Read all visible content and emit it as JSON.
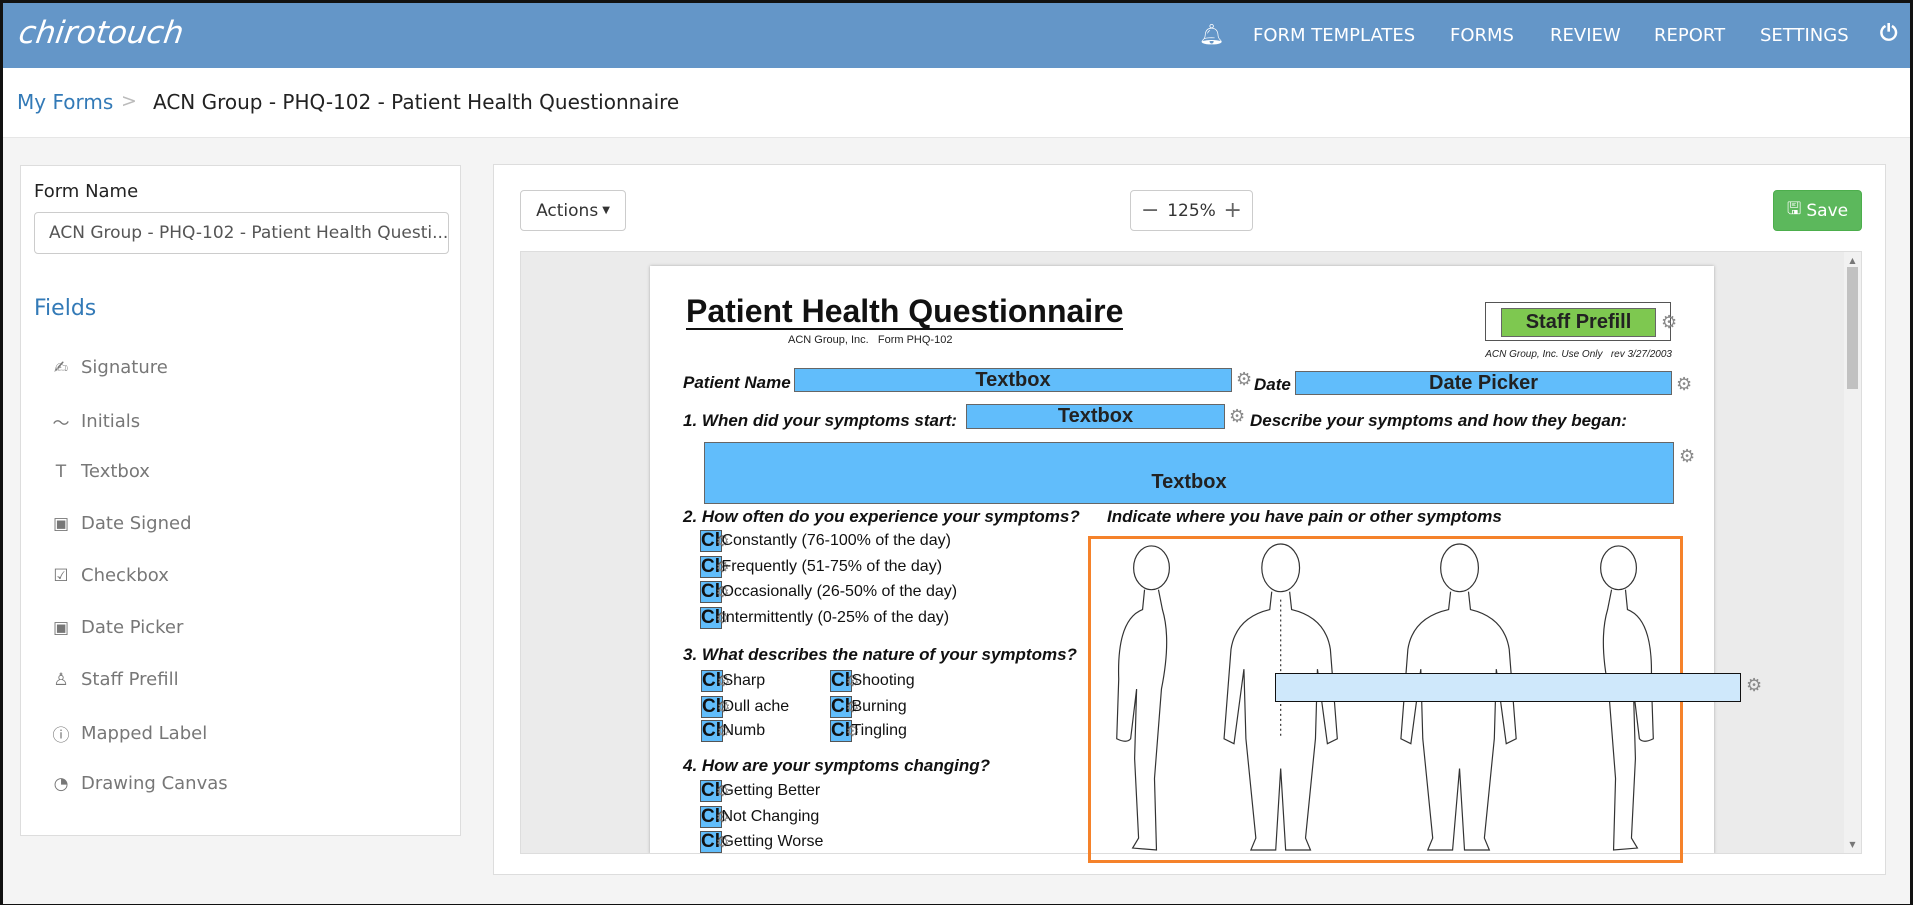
{
  "app": {
    "logo": "chirotouch"
  },
  "nav": {
    "items": [
      "FORM TEMPLATES",
      "FORMS",
      "REVIEW",
      "REPORT",
      "SETTINGS"
    ],
    "bell_icon": "bell-icon",
    "power_icon": "power-icon"
  },
  "breadcrumb": {
    "root": "My Forms",
    "separator": ">",
    "current": "ACN Group - PHQ-102 - Patient Health Questionnaire"
  },
  "sidebar": {
    "form_name_label": "Form Name",
    "form_name_value": "ACN Group - PHQ-102 - Patient Health Questi...",
    "fields_heading": "Fields",
    "items": [
      {
        "label": "Signature",
        "icon": "✍"
      },
      {
        "label": "Initials",
        "icon": "〜"
      },
      {
        "label": "Textbox",
        "icon": "T"
      },
      {
        "label": "Date Signed",
        "icon": "▣"
      },
      {
        "label": "Checkbox",
        "icon": "☑"
      },
      {
        "label": "Date Picker",
        "icon": "▣"
      },
      {
        "label": "Staff Prefill",
        "icon": "♙"
      },
      {
        "label": "Mapped Label",
        "icon": "ⓘ"
      },
      {
        "label": "Drawing Canvas",
        "icon": "◔"
      }
    ]
  },
  "toolbar": {
    "actions": "Actions",
    "zoom": "125%",
    "minus": "−",
    "plus": "+",
    "save": "Save"
  },
  "form": {
    "title": "Patient Health Questionnaire",
    "subtitle": "ACN Group, Inc.   Form PHQ-102",
    "staff_prefill": "Staff Prefill",
    "use_only": "ACN Group, Inc. Use Only   rev 3/27/2003",
    "patient_name_label": "Patient Name",
    "textbox": "Textbox",
    "date_label": "Date",
    "date_picker": "Date Picker",
    "q1": "1. When did your symptoms start:",
    "describe": "Describe your symptoms and how they began:",
    "q2": "2. How often do you experience your symptoms?",
    "indicate": "Indicate where you have pain or other symptoms",
    "q2_options": [
      "Constantly (76-100% of the day)",
      "Frequently (51-75% of the day)",
      "Occasionally (26-50% of the day)",
      "Intermittently (0-25% of the day)"
    ],
    "q3": "3. What describes the nature of your symptoms?",
    "q3_options": [
      "Sharp",
      "Dull ache",
      "Numb",
      "Shooting",
      "Burning",
      "Tingling"
    ],
    "q4": "4. How are your symptoms changing?",
    "q4_options": [
      "Getting Better",
      "Not Changing",
      "Getting Worse"
    ],
    "cb_label": "Ch"
  },
  "colors": {
    "nav": "#6496c8",
    "field": "#61bdfb",
    "prefill": "#7ec850",
    "save": "#5cb85c",
    "highlight": "#f5822a"
  }
}
